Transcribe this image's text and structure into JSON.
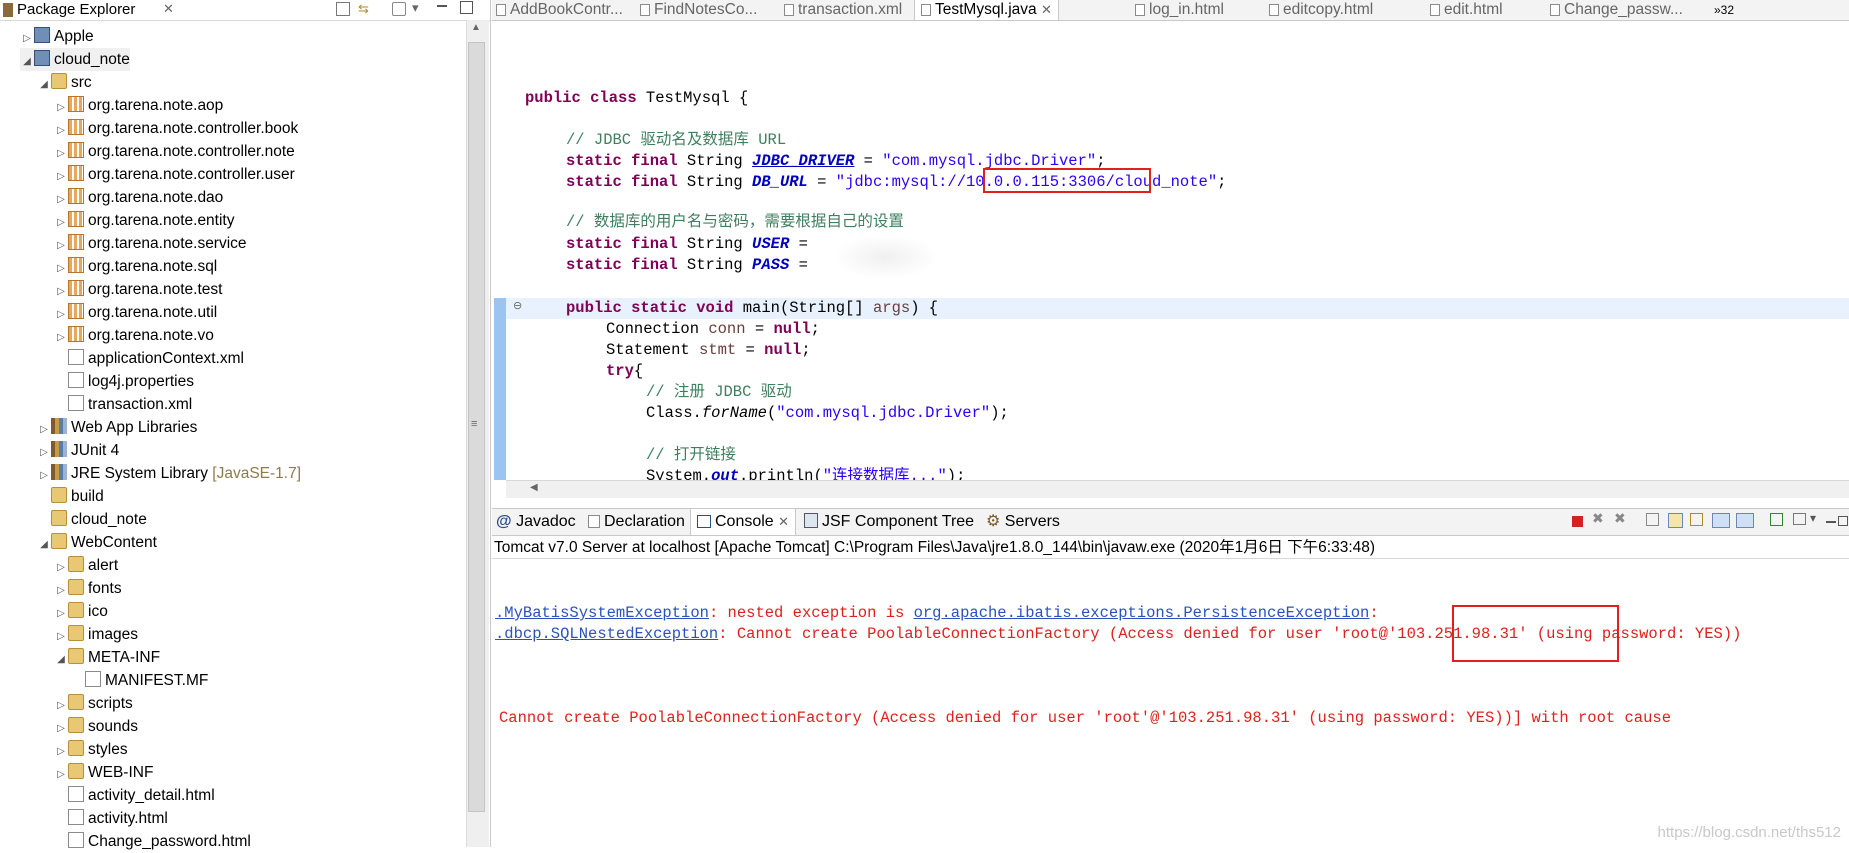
{
  "package_explorer": {
    "title": "Package Explorer",
    "items": [
      {
        "label": "Apple",
        "icon": "project-icon"
      },
      {
        "label": "cloud_note",
        "icon": "project-icon"
      },
      {
        "label": "src",
        "icon": "source-folder-icon"
      },
      {
        "label": "org.tarena.note.aop",
        "icon": "package-icon"
      },
      {
        "label": "org.tarena.note.controller.book",
        "icon": "package-icon"
      },
      {
        "label": "org.tarena.note.controller.note",
        "icon": "package-icon"
      },
      {
        "label": "org.tarena.note.controller.user",
        "icon": "package-icon"
      },
      {
        "label": "org.tarena.note.dao",
        "icon": "package-icon"
      },
      {
        "label": "org.tarena.note.entity",
        "icon": "package-icon"
      },
      {
        "label": "org.tarena.note.service",
        "icon": "package-icon"
      },
      {
        "label": "org.tarena.note.sql",
        "icon": "package-icon"
      },
      {
        "label": "org.tarena.note.test",
        "icon": "package-icon"
      },
      {
        "label": "org.tarena.note.util",
        "icon": "package-icon"
      },
      {
        "label": "org.tarena.note.vo",
        "icon": "package-icon"
      },
      {
        "label": "applicationContext.xml",
        "icon": "xml-file-icon"
      },
      {
        "label": "log4j.properties",
        "icon": "file-icon"
      },
      {
        "label": "transaction.xml",
        "icon": "xml-file-icon"
      },
      {
        "label": "Web App Libraries",
        "icon": "library-icon"
      },
      {
        "label": "JUnit 4",
        "icon": "library-icon"
      },
      {
        "label": "JRE System Library",
        "suffix": "[JavaSE-1.7]",
        "icon": "library-icon"
      },
      {
        "label": "build",
        "icon": "folder-icon"
      },
      {
        "label": "cloud_note",
        "icon": "folder-icon"
      },
      {
        "label": "WebContent",
        "icon": "folder-icon"
      },
      {
        "label": "alert",
        "icon": "folder-icon"
      },
      {
        "label": "fonts",
        "icon": "folder-icon"
      },
      {
        "label": "ico",
        "icon": "folder-icon"
      },
      {
        "label": "images",
        "icon": "folder-icon"
      },
      {
        "label": "META-INF",
        "icon": "folder-icon"
      },
      {
        "label": "MANIFEST.MF",
        "icon": "file-icon"
      },
      {
        "label": "scripts",
        "icon": "folder-icon"
      },
      {
        "label": "sounds",
        "icon": "folder-icon"
      },
      {
        "label": "styles",
        "icon": "folder-icon"
      },
      {
        "label": "WEB-INF",
        "icon": "folder-icon"
      },
      {
        "label": "activity_detail.html",
        "icon": "html-file-icon"
      },
      {
        "label": "activity.html",
        "icon": "html-file-icon"
      },
      {
        "label": "Change_password.html",
        "icon": "html-file-icon"
      }
    ]
  },
  "editor_tabs": [
    {
      "label": "AddBookContr..."
    },
    {
      "label": "FindNotesCo..."
    },
    {
      "label": "transaction.xml"
    },
    {
      "label": "TestMysql.java",
      "active": true
    },
    {
      "label": "log_in.html"
    },
    {
      "label": "editcopy.html"
    },
    {
      "label": "edit.html"
    },
    {
      "label": "Change_passw..."
    },
    {
      "label": "»32"
    }
  ],
  "code": {
    "class_decl_kw": "public class",
    "class_name": " TestMysql {",
    "comment1": "// JDBC 驱动名及数据库 URL",
    "sfs": "static final",
    "string_type": " String ",
    "jdbc_driver_name": "JDBC_DRIVER",
    "jdbc_driver_value": "\"com.mysql.jdbc.Driver\"",
    "db_url_name": "DB_URL",
    "db_url_part1": "\"jdbc:mysql:/",
    "db_url_host": "/10.0.0.115:3306",
    "db_url_part2": "/cloud_note\"",
    "comment2": "// 数据库的用户名与密码，需要根据自己的设置",
    "user_name": "USER",
    "pass_name": "PASS",
    "main_kw": "public static void",
    "main_sig": " main(String[] ",
    "main_args": "args",
    "main_end": ") {",
    "conn_type": "Connection ",
    "conn_var": "conn",
    "null_kw": "null",
    "stmt_type": "Statement ",
    "stmt_var": "stmt",
    "try_kw": "try",
    "comment3": "// 注册 JDBC 驱动",
    "class_forname_pre": "Class.",
    "class_forname_method": "forName",
    "class_forname_arg": "\"com.mysql.jdbc.Driver\"",
    "comment4": "// 打开链接",
    "println_pre": "System.",
    "println_out": "out",
    "println_mid": ".println(",
    "println_arg": "\"连接数据库...\""
  },
  "bottom_tabs": [
    {
      "label": "Javadoc",
      "icon": "javadoc-icon"
    },
    {
      "label": "Declaration",
      "icon": "declaration-icon"
    },
    {
      "label": "Console",
      "icon": "console-icon",
      "active": true
    },
    {
      "label": "JSF Component Tree",
      "icon": "jsf-tree-icon"
    },
    {
      "label": "Servers",
      "icon": "servers-icon"
    }
  ],
  "console": {
    "description": "Tomcat v7.0 Server at localhost [Apache Tomcat] C:\\Program Files\\Java\\jre1.8.0_144\\bin\\javaw.exe (2020年1月6日 下午6:33:48)",
    "line1_link1": ".MyBatisSystemException",
    "line1_text": ": nested exception is ",
    "line1_link2": "org.apache.ibatis.exceptions.PersistenceException",
    "line1_end": ":",
    "line2_link": ".dbcp.SQLNestedException",
    "line2_text": ": Cannot create PoolableConnectionFactory (Access denied for user 'root",
    "line2_host": "@'103.251.98.31'",
    "line2_end": " (using password: YES))",
    "line3": "Cannot create PoolableConnectionFactory (Access denied for user 'root'@'103.251.98.31' (using password: YES))] with root cause"
  },
  "watermark": "https://blog.csdn.net/ths512"
}
